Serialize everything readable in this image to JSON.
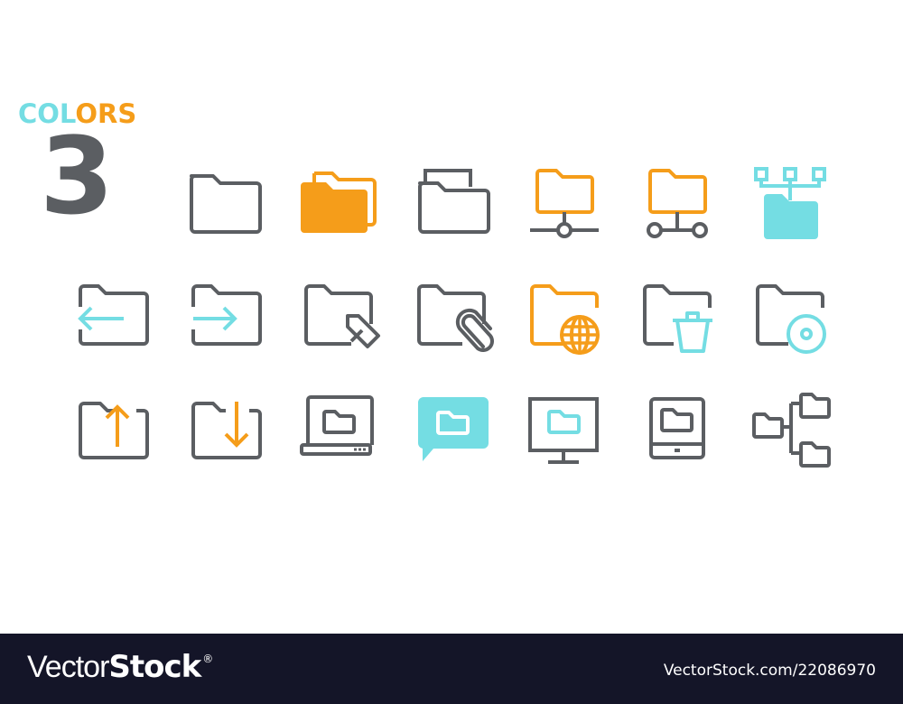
{
  "heading": {
    "colors_part1": "COL",
    "colors_part2": "ORS",
    "count": "3"
  },
  "palette": {
    "gray": "#5b5e62",
    "orange": "#f59d1a",
    "cyan": "#74dde3",
    "footer_bg": "#141528"
  },
  "icon_grid": {
    "rows": [
      [
        "folder",
        "folders-stack",
        "folder-document",
        "folder-network",
        "folder-shared-network",
        "folder-hierarchy"
      ],
      [
        "folder-import",
        "folder-export",
        "folder-edit",
        "folder-attachment",
        "folder-web",
        "folder-delete",
        "folder-disc"
      ],
      [
        "folder-upload",
        "folder-download",
        "laptop-folder",
        "chat-folder",
        "monitor-folder",
        "tablet-folder",
        "folder-tree"
      ]
    ]
  },
  "footer": {
    "brand_light": "Vector",
    "brand_bold": "Stock",
    "brand_mark": "®",
    "reference": "VectorStock.com/22086970"
  }
}
